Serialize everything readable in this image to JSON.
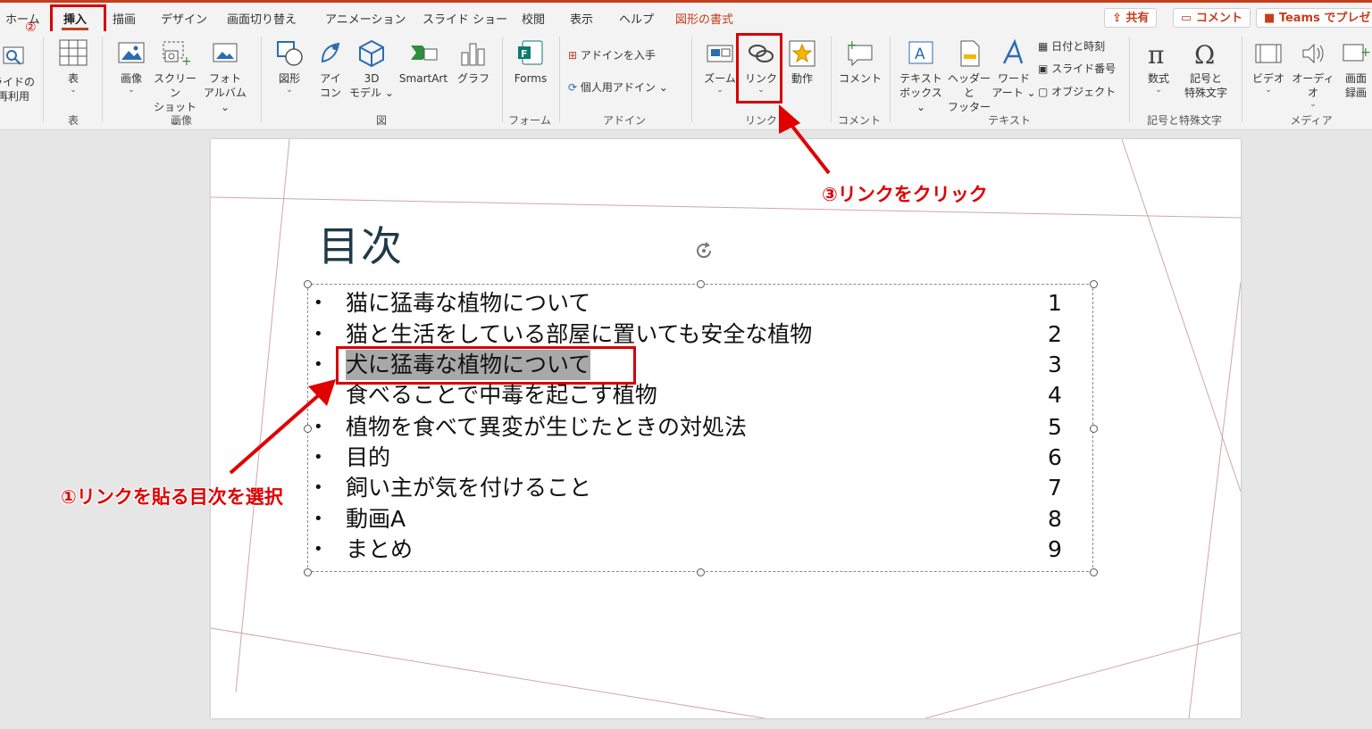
{
  "tabs": [
    "ホーム",
    "挿入",
    "描画",
    "デザイン",
    "画面切り替え",
    "アニメーション",
    "スライド ショー",
    "校閲",
    "表示",
    "ヘルプ",
    "図形の書式"
  ],
  "top_buttons": {
    "share": "共有",
    "comment": "コメント",
    "teams": "Teams でプレゼ"
  },
  "ribbon": {
    "reuse": [
      "ライドの",
      "再利用"
    ],
    "table": "表",
    "image": "画像",
    "screenshot": [
      "スクリーン",
      "ショット"
    ],
    "album": [
      "フォト",
      "アルバム"
    ],
    "shape": "図形",
    "icon": [
      "アイ",
      "コン"
    ],
    "model3d": [
      "3D",
      "モデル"
    ],
    "smartart": "SmartArt",
    "chart": "グラフ",
    "forms": "Forms",
    "get_addins": "アドインを入手",
    "my_addins": "個人用アドイン",
    "zoom": "ズーム",
    "link": "リンク",
    "action": "動作",
    "comment": "コメント",
    "textbox": [
      "テキスト",
      "ボックス"
    ],
    "header_footer": [
      "ヘッダーと",
      "フッター"
    ],
    "wordart": [
      "ワード",
      "アート"
    ],
    "datetime": "日付と時刻",
    "slide_number": "スライド番号",
    "object": "オブジェクト",
    "equation": "数式",
    "symbol": [
      "記号と",
      "特殊文字"
    ],
    "video": "ビデオ",
    "audio": "オーディオ",
    "screen_rec": [
      "画面",
      "録画"
    ]
  },
  "groups": {
    "table": "表",
    "image": "画像",
    "illustration": "図",
    "forms": "フォーム",
    "addins": "アドイン",
    "links": "リンク",
    "comments": "コメント",
    "text": "テキスト",
    "symbols": "記号と特殊文字",
    "media": "メディア"
  },
  "slide": {
    "title": "目次",
    "items": [
      {
        "text": "猫に猛毒な植物について",
        "num": "1"
      },
      {
        "text": "猫と生活をしている部屋に置いても安全な植物",
        "num": "2"
      },
      {
        "text": "犬に猛毒な植物について",
        "num": "3"
      },
      {
        "text": "食べることで中毒を起こす植物",
        "num": "4"
      },
      {
        "text": "植物を食べて異変が生じたときの対処法",
        "num": "5"
      },
      {
        "text": "目的",
        "num": "6"
      },
      {
        "text": "飼い主が気を付けること",
        "num": "7"
      },
      {
        "text": "動画A",
        "num": "8"
      },
      {
        "text": "まとめ",
        "num": "9"
      }
    ]
  },
  "annotations": {
    "step1": "①リンクを貼る目次を選択",
    "step2": "②",
    "step3": "③リンクをクリック"
  },
  "colors": {
    "accent": "#c43e1c",
    "annotation_red": "#e00000",
    "title_color": "#1e3a48"
  }
}
